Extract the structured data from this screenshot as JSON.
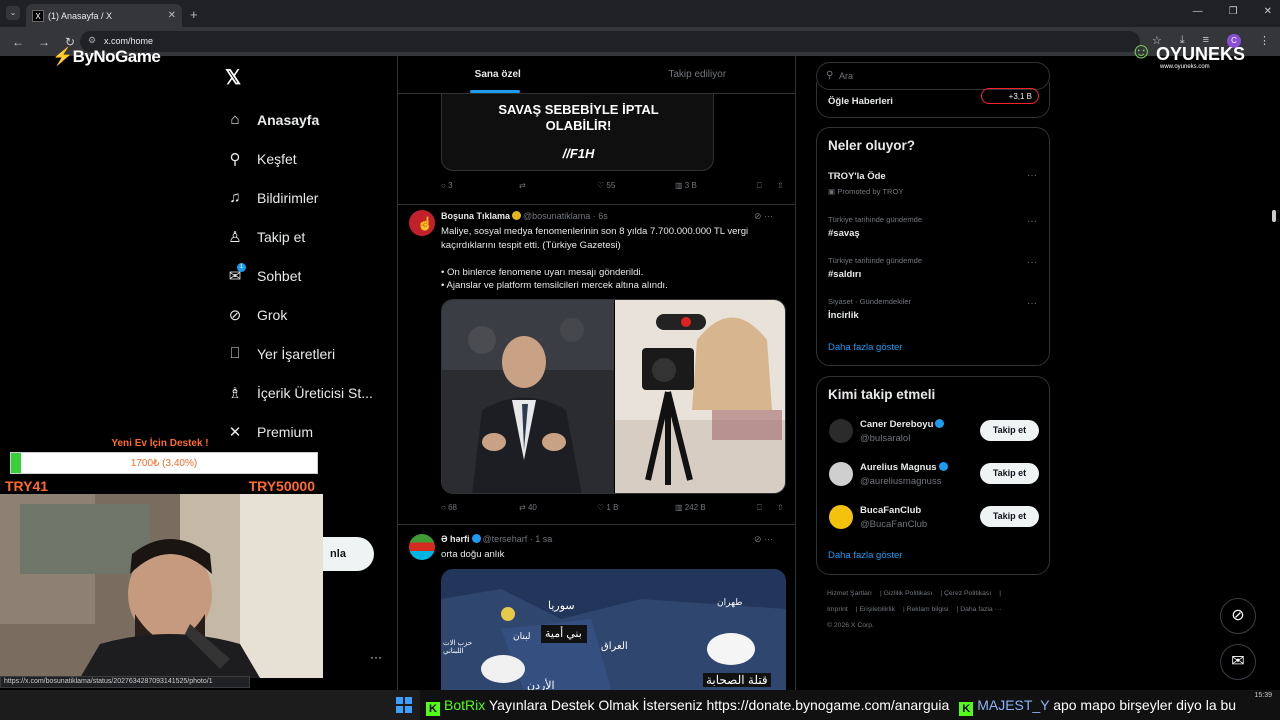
{
  "browser": {
    "tab_title": "(1) Anasayfa / X",
    "url": "x.com/home",
    "new_tab": "+",
    "tab_close": "✕",
    "win_controls": [
      "—",
      "❐",
      "✕"
    ],
    "status_url": "https://x.com/bosunatiklama/status/2027634287093141525/photo/1"
  },
  "overlay": {
    "bynogame_logo": "ByNoGame",
    "oyuneks_logo": "OYUNEKS",
    "oyuneks_url": "www.oyuneks.com",
    "donation": {
      "title": "Yeni Ev İçin Destek !",
      "progress_text": "1700₺ (3.40%)",
      "progress_fraction": 0.034,
      "min_label": "TRY41",
      "max_label": "TRY50000"
    },
    "ticker": {
      "user1": "BotRix",
      "message1": "Yayınlara Destek Olmak İsterseniz https://donate.bynogame.com/anarguia",
      "user2": "MAJEST_Y",
      "message2": "apo mapo birşeyler diyo la bu"
    },
    "clock": "15:39"
  },
  "sidebar": {
    "items": [
      {
        "label": "Anasayfa",
        "icon": "home-icon"
      },
      {
        "label": "Keşfet",
        "icon": "search-icon"
      },
      {
        "label": "Bildirimler",
        "icon": "bell-icon"
      },
      {
        "label": "Takip et",
        "icon": "follow-icon"
      },
      {
        "label": "Sohbet",
        "icon": "mail-icon",
        "badge": "1"
      },
      {
        "label": "Grok",
        "icon": "grok-icon"
      },
      {
        "label": "Yer İşaretleri",
        "icon": "bookmark-icon"
      },
      {
        "label": "İçerik Üreticisi St...",
        "icon": "creator-icon"
      },
      {
        "label": "Premium",
        "icon": "x-icon"
      }
    ],
    "post_button_visible": "nla",
    "more": "···"
  },
  "feed": {
    "tabs": [
      "Sana özel",
      "Takip ediliyor"
    ],
    "tweet0": {
      "image_title_line1": "SAVAŞ SEBEBİYLE İPTAL",
      "image_title_line2": "OLABİLİR!",
      "image_brand": "//F1H",
      "replies": "3",
      "likes": "55",
      "views": "3 B"
    },
    "tweet1": {
      "name": "Boşuna Tıklama",
      "handle": "@bosunatiklama · 6s",
      "text": "Maliye, sosyal medya fenomenlerinin son 8 yılda 7.700.000.000 TL vergi kaçırdıklarını tespit etti. (Türkiye Gazetesi)\n\n• On binlerce fenomene uyarı mesajı gönderildi.\n• Ajanslar ve platform temsilcileri mercek altına alındı.",
      "replies": "68",
      "retweets": "40",
      "likes": "1 B",
      "views": "242 B"
    },
    "tweet2": {
      "name": "Ə hərfi",
      "handle": "@terseharf · 1 sa",
      "text": "orta doğu anlık",
      "map_labels": [
        "سوريا",
        "بني أمية",
        "لبنان",
        "العراق",
        "الأردن",
        "قتلة الصحابة",
        "طهران",
        "حزب الات اللبناني"
      ]
    }
  },
  "right": {
    "search_placeholder": "Ara",
    "live": {
      "title": "Öğle Haberleri",
      "count": "+3,1 B"
    },
    "trends_title": "Neler oluyor?",
    "trends": [
      {
        "category": "",
        "name": "TROY'la Öde",
        "promo": "Promoted by TROY"
      },
      {
        "category": "Türkiye tarihinde gündemde",
        "name": "#savaş"
      },
      {
        "category": "Türkiye tarihinde gündemde",
        "name": "#saldırı"
      },
      {
        "category": "Siyaset · Gündemdekiler",
        "name": "İncirlik"
      }
    ],
    "show_more": "Daha fazla göster",
    "who_title": "Kimi takip etmeli",
    "who": [
      {
        "name": "Caner Dereboyu",
        "handle": "@bulsaralol",
        "verified": true
      },
      {
        "name": "Aurelius Magnus",
        "handle": "@aureliusmagnuss",
        "verified": true
      },
      {
        "name": "BucaFanClub",
        "handle": "@BucaFanClub",
        "verified": false
      }
    ],
    "follow_label": "Takip et",
    "footer": [
      "Hizmet Şartları",
      "Gizlilik Politikası",
      "Çerez Politikası",
      "Imprint",
      "Erişilebilirlik",
      "Reklam bilgisi",
      "Daha fazla ···",
      "© 2026 X Corp."
    ]
  },
  "colors": {
    "accent": "#1d9bf0",
    "gold_check": "#e2b719",
    "kick_green": "#53fc18",
    "donation_orange": "#ff6a2a"
  }
}
